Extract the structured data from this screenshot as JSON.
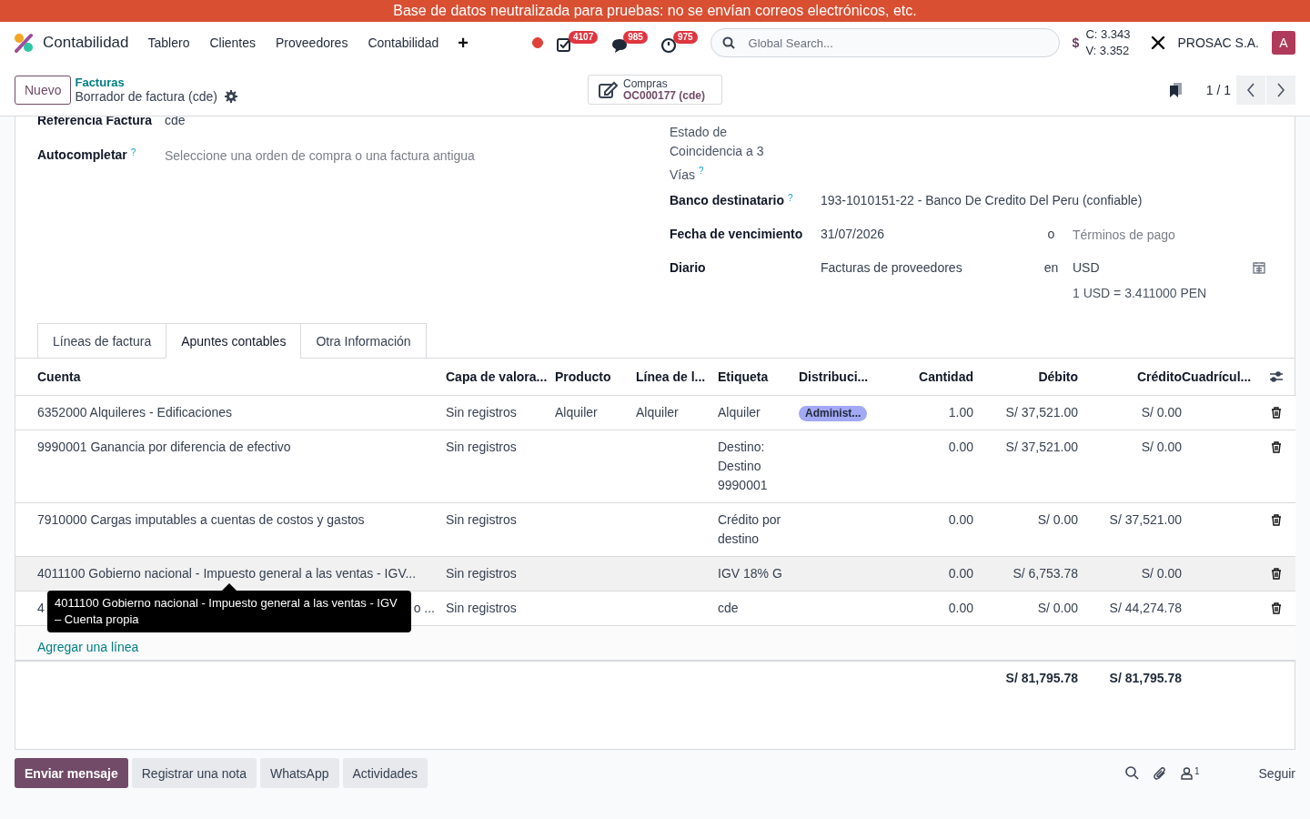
{
  "banner": {
    "text": "Base de datos neutralizada para pruebas: no se envían correos electrónicos, etc."
  },
  "navbar": {
    "app": "Contabilidad",
    "menus": [
      "Tablero",
      "Clientes",
      "Proveedores",
      "Contabilidad"
    ],
    "add_symbol": "+",
    "recording": true,
    "counters": [
      {
        "kind": "activities",
        "count": "4107"
      },
      {
        "kind": "messages",
        "count": "985"
      },
      {
        "kind": "timer",
        "count": "975"
      }
    ],
    "search": {
      "placeholder": "Global Search..."
    },
    "currency_symbol": "$",
    "rate_buy": "C: 3.343",
    "rate_sell": "V: 3.352",
    "company": "PROSAC S.A.",
    "avatar": "A"
  },
  "control_panel": {
    "new_button": "Nuevo",
    "breadcrumb": "Facturas",
    "record": "Borrador de factura (cde)",
    "smart_button": {
      "label": "Compras",
      "value": "OC000177 (cde)"
    },
    "pager": "1 / 1"
  },
  "form": {
    "left": [
      {
        "label": "Referencia Factura",
        "value": "cde"
      },
      {
        "label": "Autocompletar",
        "help": "?",
        "placeholder": "Seleccione una orden de compra o una factura antigua"
      }
    ],
    "match_label": "Estado de Coincidencia a 3 Vías",
    "match_help": "?",
    "right": [
      {
        "label": "Banco destinatario",
        "help": "?",
        "value": "193-1010151-22 - Banco De Credito Del Peru (confiable)"
      },
      {
        "label": "Fecha de vencimiento",
        "value": "31/07/2026",
        "joiner": "o",
        "extra_placeholder": "Términos de pago"
      },
      {
        "label": "Diario",
        "value": "Facturas de proveedores",
        "joiner": "en",
        "extra": "USD",
        "calendar": true,
        "note": "1 USD = 3.411000 PEN"
      }
    ]
  },
  "tabs": [
    {
      "label": "Líneas de factura",
      "selected": false
    },
    {
      "label": "Apuntes contables",
      "selected": true
    },
    {
      "label": "Otra Información",
      "selected": false
    }
  ],
  "table": {
    "columns": [
      "Cuenta",
      "Capa de valora...",
      "Producto",
      "Línea de l...",
      "Etiqueta",
      "Distribuci...",
      "Cantidad",
      "Débito",
      "Crédito",
      "Cuadrícul..."
    ],
    "rows": [
      {
        "highlighted": false,
        "account": "6352000 Alquileres - Edificaciones",
        "layer": "Sin registros",
        "product": "Alquiler",
        "line": "Alquiler",
        "label": "Alquiler",
        "distribution": "Administ...",
        "quantity": "1.00",
        "debit": "S/ 37,521.00",
        "credit": "S/ 0.00"
      },
      {
        "highlighted": false,
        "account": "9990001 Ganancia por diferencia de efectivo",
        "layer": "Sin registros",
        "label": "Destino: Destino 9990001",
        "quantity": "0.00",
        "debit": "S/ 37,521.00",
        "credit": "S/ 0.00"
      },
      {
        "highlighted": false,
        "account": "7910000 Cargas imputables a cuentas de costos y gastos",
        "layer": "Sin registros",
        "label": "Crédito por destino",
        "quantity": "0.00",
        "debit": "S/ 0.00",
        "credit": "S/ 37,521.00"
      },
      {
        "highlighted": true,
        "account": "4011100 Gobierno nacional - Impuesto general a las ventas - IGV...",
        "layer": "Sin registros",
        "label": "IGV 18% G",
        "quantity": "0.00",
        "debit": "S/ 6,753.78",
        "credit": "S/ 0.00"
      },
      {
        "highlighted": false,
        "account_start": "4",
        "account_end": "o ...",
        "layer": "Sin registros",
        "label": "cde",
        "quantity": "0.00",
        "debit": "S/ 0.00",
        "credit": "S/ 44,274.78"
      }
    ],
    "add_line": "Agregar una línea",
    "total_debit": "S/ 81,795.78",
    "total_credit": "S/ 81,795.78"
  },
  "tooltip": "4011100 Gobierno nacional - Impuesto general a las ventas - IGV – Cuenta propia",
  "chatter": {
    "buttons": [
      {
        "label": "Enviar mensaje",
        "primary": true
      },
      {
        "label": "Registrar una nota",
        "primary": false
      },
      {
        "label": "WhatsApp",
        "primary": false
      },
      {
        "label": "Actividades",
        "primary": false
      }
    ],
    "followers": "1",
    "follow": "Seguir"
  }
}
